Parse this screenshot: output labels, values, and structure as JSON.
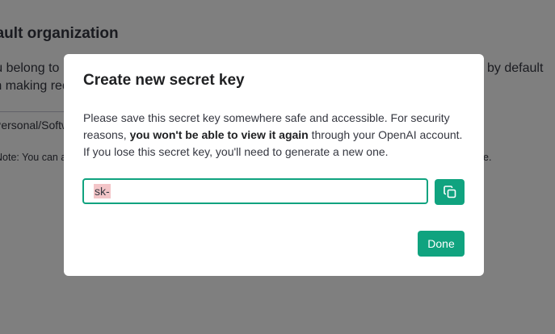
{
  "background": {
    "heading": "Default organization",
    "para_left": "If you belong to",
    "para_left_2": "when making requ",
    "para_right": "by default",
    "field_value": "Personal/Software",
    "helper_left": "Note: You can also s",
    "helper_right": "e."
  },
  "modal": {
    "title": "Create new secret key",
    "body_part1": "Please save this secret key somewhere safe and accessible. For security reasons, ",
    "body_bold": "you won't be able to view it again",
    "body_part2": " through your ",
    "body_openai": "OpenAI",
    "body_part3": " account. If you lose this secret key, you'll need to generate a new one.",
    "key_value": "sk-",
    "copy_icon": "copy-icon",
    "done_label": "Done",
    "accent_color": "#10a37f"
  }
}
